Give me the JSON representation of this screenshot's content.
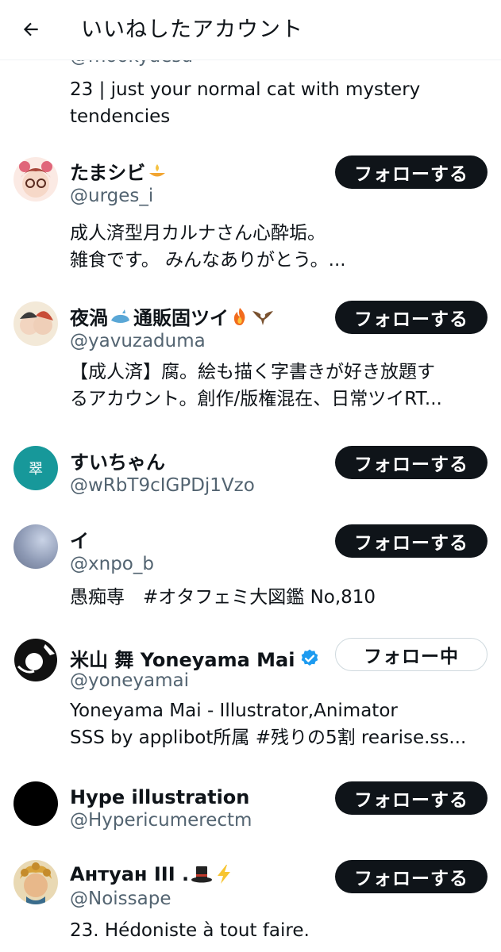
{
  "header": {
    "title": "いいねしたアカウント",
    "back_icon": "arrow-left-icon"
  },
  "colors": {
    "text_primary": "#0f1419",
    "text_secondary": "#536471",
    "button_bg": "#0f1419",
    "verified": "#1d9bf0"
  },
  "partial_user": {
    "handle": "@mookydesu",
    "bio": [
      "23 | just your normal cat with mystery",
      "tendencies"
    ]
  },
  "users": [
    {
      "name": "たまシビ",
      "handle": "@urges_i",
      "bio": [
        "成人済型月カルナさん心酔垢。",
        "雑食です。 みんなありがとう。..."
      ],
      "button": "フォローする"
    },
    {
      "name": "夜渦",
      "name_rest": "通販固ツイ",
      "handle": "@yavuzaduma",
      "bio": [
        "【成人済】腐。絵も描く字書きが好き放題す",
        "るアカウント。創作/版権混在、日常ツイRT..."
      ],
      "button": "フォローする"
    },
    {
      "name": "すいちゃん",
      "avatar_text": "翠",
      "handle": "@wRbT9cIGPDj1Vzo",
      "bio": [],
      "button": "フォローする"
    },
    {
      "name": "イ",
      "handle": "@xnpo_b",
      "bio": [
        "愚痴専　#オタフェミ大図鑑 No,810"
      ],
      "button": "フォローする"
    },
    {
      "name": "米山 舞 Yoneyama Mai",
      "handle": "@yoneyamai",
      "verified": true,
      "bio": [
        "Yoneyama Mai - Illustrator,Animator",
        "SSS by applibot所属 #残りの5割 rearise.ss..."
      ],
      "button": "フォロー中"
    },
    {
      "name": "Hype illustration",
      "handle": "@Hypericumerectm",
      "bio": [],
      "button": "フォローする"
    },
    {
      "name": "Антуан III .",
      "handle": "@Noissape",
      "bio": [
        "23. Hédoniste à tout faire."
      ],
      "button": "フォローする"
    }
  ]
}
